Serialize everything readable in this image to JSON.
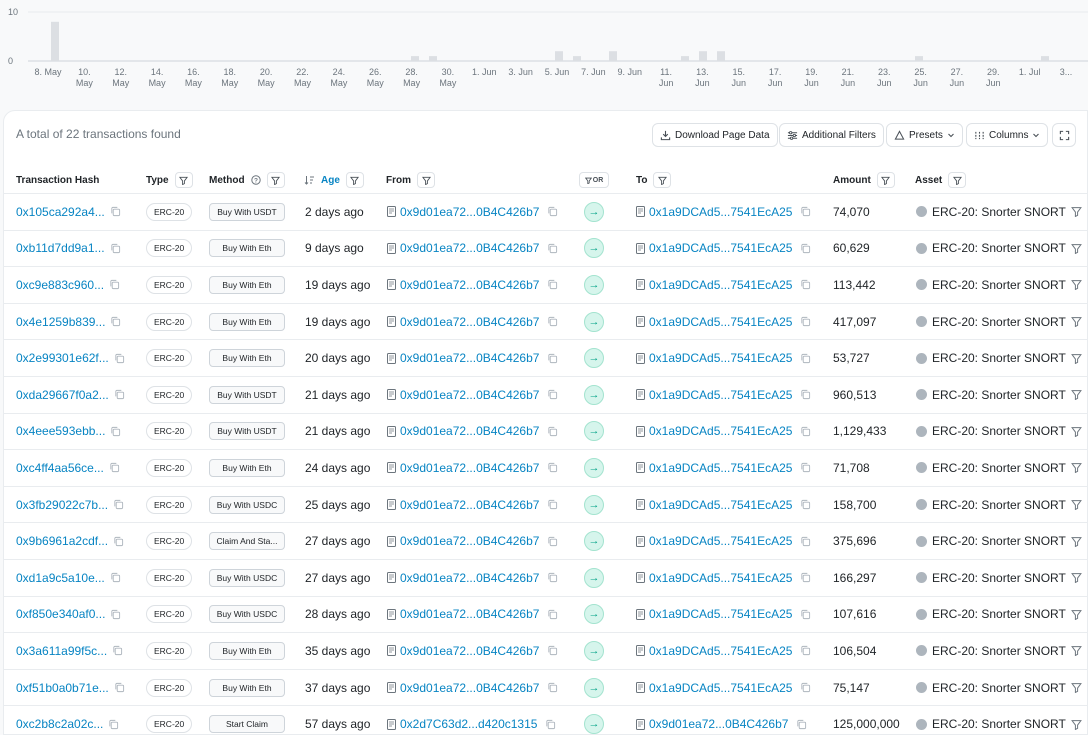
{
  "chart": {
    "y_ticks": [
      "10",
      "0"
    ],
    "x_ticks": [
      [
        "8. May"
      ],
      [
        "10.",
        "May"
      ],
      [
        "12.",
        "May"
      ],
      [
        "14.",
        "May"
      ],
      [
        "16.",
        "May"
      ],
      [
        "18.",
        "May"
      ],
      [
        "20.",
        "May"
      ],
      [
        "22.",
        "May"
      ],
      [
        "24.",
        "May"
      ],
      [
        "26.",
        "May"
      ],
      [
        "28.",
        "May"
      ],
      [
        "30.",
        "May"
      ],
      [
        "1. Jun"
      ],
      [
        "3. Jun"
      ],
      [
        "5. Jun"
      ],
      [
        "7. Jun"
      ],
      [
        "9. Jun"
      ],
      [
        "11.",
        "Jun"
      ],
      [
        "13.",
        "Jun"
      ],
      [
        "15.",
        "Jun"
      ],
      [
        "17.",
        "Jun"
      ],
      [
        "19.",
        "Jun"
      ],
      [
        "21.",
        "Jun"
      ],
      [
        "23.",
        "Jun"
      ],
      [
        "25.",
        "Jun"
      ],
      [
        "27.",
        "Jun"
      ],
      [
        "29.",
        "Jun"
      ],
      [
        "1. Jul"
      ],
      [
        "3..."
      ]
    ]
  },
  "chart_data": {
    "type": "bar",
    "ylim": [
      0,
      10
    ],
    "grid": true,
    "x": [
      "2024-05-08",
      "2024-05-28",
      "2024-05-29",
      "2024-06-05",
      "2024-06-06",
      "2024-06-08",
      "2024-06-12",
      "2024-06-13",
      "2024-06-14",
      "2024-06-25",
      "2024-07-02"
    ],
    "values": [
      8,
      1,
      1,
      2,
      1,
      2,
      1,
      2,
      2,
      1,
      1
    ]
  },
  "summary": "A total of 22 transactions found",
  "toolbar": {
    "download": "Download Page Data",
    "filters": "Additional Filters",
    "presets": "Presets",
    "columns": "Columns"
  },
  "headers": {
    "hash": "Transaction Hash",
    "type": "Type",
    "method": "Method",
    "age": "Age",
    "from": "From",
    "or": "OR",
    "to": "To",
    "amount": "Amount",
    "asset": "Asset"
  },
  "rows": [
    {
      "hash": "0x105ca292a4...",
      "type": "ERC-20",
      "method": "Buy With USDT",
      "age": "2 days ago",
      "from": "0x9d01ea72...0B4C426b7",
      "to": "0x1a9DCAd5...7541EcA25",
      "amount": "74,070",
      "asset": "ERC-20: Snorter SNORT"
    },
    {
      "hash": "0xb11d7dd9a1...",
      "type": "ERC-20",
      "method": "Buy With Eth",
      "age": "9 days ago",
      "from": "0x9d01ea72...0B4C426b7",
      "to": "0x1a9DCAd5...7541EcA25",
      "amount": "60,629",
      "asset": "ERC-20: Snorter SNORT"
    },
    {
      "hash": "0xc9e883c960...",
      "type": "ERC-20",
      "method": "Buy With Eth",
      "age": "19 days ago",
      "from": "0x9d01ea72...0B4C426b7",
      "to": "0x1a9DCAd5...7541EcA25",
      "amount": "113,442",
      "asset": "ERC-20: Snorter SNORT"
    },
    {
      "hash": "0x4e1259b839...",
      "type": "ERC-20",
      "method": "Buy With Eth",
      "age": "19 days ago",
      "from": "0x9d01ea72...0B4C426b7",
      "to": "0x1a9DCAd5...7541EcA25",
      "amount": "417,097",
      "asset": "ERC-20: Snorter SNORT"
    },
    {
      "hash": "0x2e99301e62f...",
      "type": "ERC-20",
      "method": "Buy With Eth",
      "age": "20 days ago",
      "from": "0x9d01ea72...0B4C426b7",
      "to": "0x1a9DCAd5...7541EcA25",
      "amount": "53,727",
      "asset": "ERC-20: Snorter SNORT"
    },
    {
      "hash": "0xda29667f0a2...",
      "type": "ERC-20",
      "method": "Buy With USDT",
      "age": "21 days ago",
      "from": "0x9d01ea72...0B4C426b7",
      "to": "0x1a9DCAd5...7541EcA25",
      "amount": "960,513",
      "asset": "ERC-20: Snorter SNORT"
    },
    {
      "hash": "0x4eee593ebb...",
      "type": "ERC-20",
      "method": "Buy With USDT",
      "age": "21 days ago",
      "from": "0x9d01ea72...0B4C426b7",
      "to": "0x1a9DCAd5...7541EcA25",
      "amount": "1,129,433",
      "asset": "ERC-20: Snorter SNORT"
    },
    {
      "hash": "0xc4ff4aa56ce...",
      "type": "ERC-20",
      "method": "Buy With Eth",
      "age": "24 days ago",
      "from": "0x9d01ea72...0B4C426b7",
      "to": "0x1a9DCAd5...7541EcA25",
      "amount": "71,708",
      "asset": "ERC-20: Snorter SNORT"
    },
    {
      "hash": "0x3fb29022c7b...",
      "type": "ERC-20",
      "method": "Buy With USDC",
      "age": "25 days ago",
      "from": "0x9d01ea72...0B4C426b7",
      "to": "0x1a9DCAd5...7541EcA25",
      "amount": "158,700",
      "asset": "ERC-20: Snorter SNORT"
    },
    {
      "hash": "0x9b6961a2cdf...",
      "type": "ERC-20",
      "method": "Claim And Sta...",
      "age": "27 days ago",
      "from": "0x9d01ea72...0B4C426b7",
      "to": "0x1a9DCAd5...7541EcA25",
      "amount": "375,696",
      "asset": "ERC-20: Snorter SNORT"
    },
    {
      "hash": "0xd1a9c5a10e...",
      "type": "ERC-20",
      "method": "Buy With USDC",
      "age": "27 days ago",
      "from": "0x9d01ea72...0B4C426b7",
      "to": "0x1a9DCAd5...7541EcA25",
      "amount": "166,297",
      "asset": "ERC-20: Snorter SNORT"
    },
    {
      "hash": "0xf850e340af0...",
      "type": "ERC-20",
      "method": "Buy With USDC",
      "age": "28 days ago",
      "from": "0x9d01ea72...0B4C426b7",
      "to": "0x1a9DCAd5...7541EcA25",
      "amount": "107,616",
      "asset": "ERC-20: Snorter SNORT"
    },
    {
      "hash": "0x3a611a99f5c...",
      "type": "ERC-20",
      "method": "Buy With Eth",
      "age": "35 days ago",
      "from": "0x9d01ea72...0B4C426b7",
      "to": "0x1a9DCAd5...7541EcA25",
      "amount": "106,504",
      "asset": "ERC-20: Snorter SNORT"
    },
    {
      "hash": "0xf51b0a0b71e...",
      "type": "ERC-20",
      "method": "Buy With Eth",
      "age": "37 days ago",
      "from": "0x9d01ea72...0B4C426b7",
      "to": "0x1a9DCAd5...7541EcA25",
      "amount": "75,147",
      "asset": "ERC-20: Snorter SNORT"
    },
    {
      "hash": "0xc2b8c2a02c...",
      "type": "ERC-20",
      "method": "Start Claim",
      "age": "57 days ago",
      "from": "0x2d7C63d2...d420c1315",
      "to": "0x9d01ea72...0B4C426b7",
      "amount": "125,000,000",
      "asset": "ERC-20: Snorter SNORT"
    }
  ],
  "colors": {
    "link": "#0784c3",
    "arrow_bg": "#d6f5ec",
    "bar": "#dcdfe3"
  }
}
